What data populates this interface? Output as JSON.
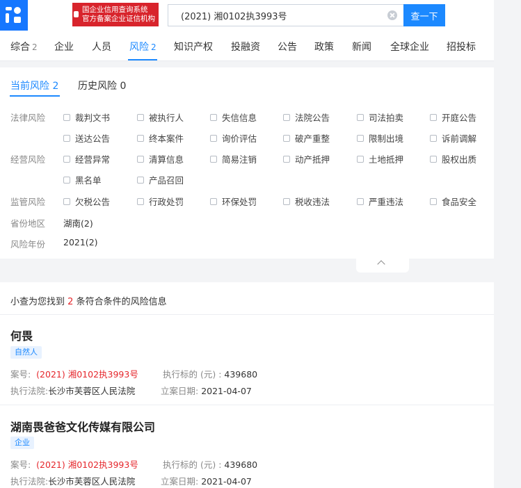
{
  "header": {
    "logo_line1": "国企业信用查询系统",
    "logo_line2": "官方备案企业证信机构",
    "search_value": "(2021) 湘0102执3993号",
    "search_button": "查一下"
  },
  "tabs": [
    {
      "label": "综合",
      "count": "2"
    },
    {
      "label": "企业",
      "count": ""
    },
    {
      "label": "人员",
      "count": ""
    },
    {
      "label": "风险",
      "count": "2"
    },
    {
      "label": "知识产权",
      "count": ""
    },
    {
      "label": "投融资",
      "count": ""
    },
    {
      "label": "公告",
      "count": ""
    },
    {
      "label": "政策",
      "count": ""
    },
    {
      "label": "新闻",
      "count": ""
    },
    {
      "label": "全球企业",
      "count": ""
    },
    {
      "label": "招投标",
      "count": ""
    }
  ],
  "active_tab": "风险",
  "subtabs": {
    "current": "当前风险 2",
    "history": "历史风险 0"
  },
  "filters": {
    "legal": {
      "label": "法律风险",
      "options": [
        "裁判文书",
        "被执行人",
        "失信信息",
        "法院公告",
        "司法拍卖",
        "开庭公告",
        "送达公告",
        "终本案件",
        "询价评估",
        "破产重整",
        "限制出境",
        "诉前调解"
      ]
    },
    "operation": {
      "label": "经营风险",
      "options": [
        "经营异常",
        "清算信息",
        "简易注销",
        "动产抵押",
        "土地抵押",
        "股权出质",
        "黑名单",
        "产品召回"
      ]
    },
    "supervision": {
      "label": "监管风险",
      "options": [
        "欠税公告",
        "行政处罚",
        "环保处罚",
        "税收违法",
        "严重违法",
        "食品安全"
      ]
    },
    "province": {
      "label": "省份地区",
      "value": "湖南(2)"
    },
    "year": {
      "label": "风险年份",
      "value": "2021(2)"
    }
  },
  "results": {
    "summary_prefix": "小查为您找到",
    "summary_count": "2",
    "summary_suffix": "条符合条件的风险信息",
    "items": [
      {
        "name": "何畏",
        "tag": "自然人",
        "case_label": "案号:",
        "case_no": "(2021) 湘0102执3993号",
        "amount_label": "执行标的 (元) :",
        "amount": "439680",
        "court_label": "执行法院:",
        "court": "长沙市芙蓉区人民法院",
        "date_label": "立案日期:",
        "date": "2021-04-07"
      },
      {
        "name": "湖南畏爸爸文化传媒有限公司",
        "tag": "企业",
        "case_label": "案号:",
        "case_no": "(2021) 湘0102执3993号",
        "amount_label": "执行标的 (元) :",
        "amount": "439680",
        "court_label": "执行法院:",
        "court": "长沙市芙蓉区人民法院",
        "date_label": "立案日期:",
        "date": "2021-04-07"
      }
    ]
  },
  "colors": {
    "accent": "#1c89ff",
    "brand_red": "#d8242c",
    "highlight": "#e5262b"
  }
}
